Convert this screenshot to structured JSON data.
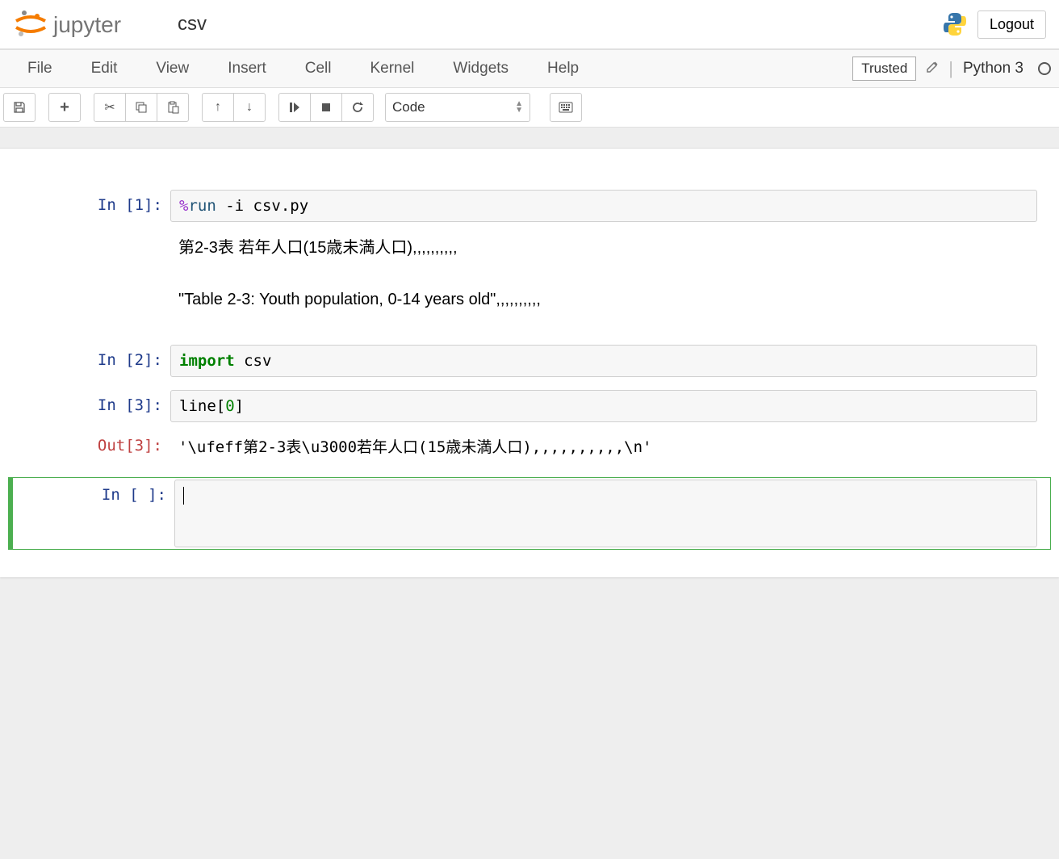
{
  "header": {
    "logo_text": "jupyter",
    "notebook_title": "csv",
    "logout_label": "Logout"
  },
  "menubar": {
    "items": [
      "File",
      "Edit",
      "View",
      "Insert",
      "Cell",
      "Kernel",
      "Widgets",
      "Help"
    ],
    "trusted_label": "Trusted",
    "kernel_name": "Python 3"
  },
  "toolbar": {
    "cell_type": "Code",
    "icons": {
      "save": "save-icon",
      "add": "plus-icon",
      "cut": "scissors-icon",
      "copy": "copy-icon",
      "paste": "paste-icon",
      "up": "arrow-up-icon",
      "down": "arrow-down-icon",
      "run": "run-icon",
      "stop": "stop-icon",
      "restart": "restart-icon",
      "keyboard": "keyboard-icon"
    }
  },
  "cells": [
    {
      "prompt_in": "In [1]:",
      "code_tokens": [
        {
          "t": "%",
          "c": "op-purple"
        },
        {
          "t": "run ",
          "c": "kw-teal"
        },
        {
          "t": "-i csv.py",
          "c": ""
        }
      ],
      "output_text": "第2-3表 若年人口(15歳未満人口),,,,,,,,,,\n\n\"Table 2-3: Youth population, 0-14 years old\",,,,,,,,,,"
    },
    {
      "prompt_in": "In [2]:",
      "code_tokens": [
        {
          "t": "import",
          "c": "kw-green"
        },
        {
          "t": " csv",
          "c": ""
        }
      ]
    },
    {
      "prompt_in": "In [3]:",
      "code_tokens": [
        {
          "t": "line[",
          "c": ""
        },
        {
          "t": "0",
          "c": "lit-green"
        },
        {
          "t": "]",
          "c": ""
        }
      ],
      "prompt_out": "Out[3]:",
      "output_result": "'\\ufeff第2-3表\\u3000若年人口(15歳未満人口),,,,,,,,,,\\n'"
    },
    {
      "prompt_in": "In [ ]:",
      "code_tokens": [],
      "selected": true
    }
  ]
}
